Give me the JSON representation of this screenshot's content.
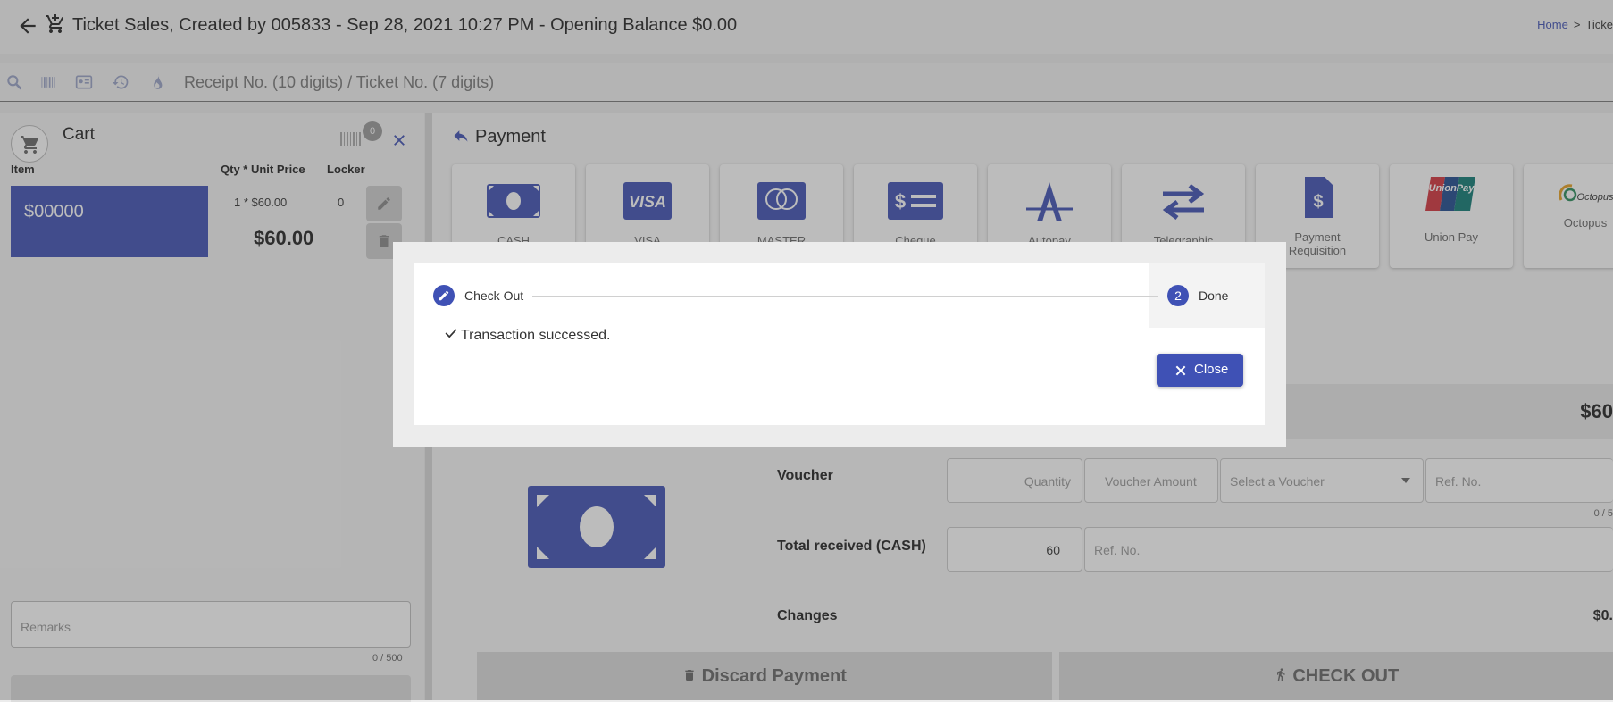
{
  "header": {
    "title": "Ticket Sales, Created by 005833 - Sep 28, 2021 10:27 PM - Opening Balance $0.00",
    "breadcrumb_home": "Home",
    "breadcrumb_sep": ">",
    "breadcrumb_current": "Ticke"
  },
  "search": {
    "placeholder": "Receipt No. (10 digits) / Ticket No. (7 digits)"
  },
  "cart": {
    "title": "Cart",
    "badge_count": "0",
    "col_item": "Item",
    "col_qty_price": "Qty * Unit Price",
    "col_locker": "Locker",
    "item_name": "$00000",
    "item_qty_price": "1 * $60.00",
    "item_locker": "0",
    "item_total": "$60.00",
    "remarks_placeholder": "Remarks",
    "remarks_count": "0 / 500"
  },
  "payment": {
    "title": "Payment",
    "methods": [
      {
        "label": "CASH",
        "icon": "cash-icon"
      },
      {
        "label": "VISA",
        "icon": "visa-icon"
      },
      {
        "label": "MASTER",
        "icon": "mastercard-icon"
      },
      {
        "label": "Cheque",
        "icon": "cheque-icon"
      },
      {
        "label": "Autopay",
        "icon": "autopay-icon"
      },
      {
        "label": "Telegraphic",
        "icon": "transfer-icon"
      },
      {
        "label": "Payment Requisition",
        "icon": "requisition-icon"
      },
      {
        "label": "Union Pay",
        "icon": "unionpay-icon"
      },
      {
        "label": "Octopus",
        "icon": "octopus-icon"
      }
    ],
    "amount_due": "$60",
    "voucher_label": "Voucher",
    "voucher_quantity_ph": "Quantity",
    "voucher_amount_ph": "Voucher Amount",
    "voucher_select_ph": "Select a Voucher",
    "voucher_ref_ph": "Ref. No.",
    "voucher_count": "0 / 5",
    "total_label": "Total received (CASH)",
    "total_value": "60",
    "total_ref_ph": "Ref. No.",
    "changes_label": "Changes",
    "changes_value": "$0.",
    "discard_label": "Discard Payment",
    "checkout_label": "CHECK OUT"
  },
  "dialog": {
    "step1_label": "Check Out",
    "step2_number": "2",
    "step2_label": "Done",
    "message": "Transaction successed.",
    "close_label": "Close"
  },
  "colors": {
    "accent": "#3f51b5"
  }
}
